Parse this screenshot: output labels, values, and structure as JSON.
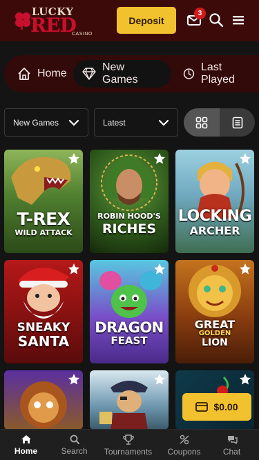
{
  "header": {
    "logo_lucky": "LUCKY",
    "logo_red": "RED",
    "logo_casino": "CASINO",
    "deposit_label": "Deposit",
    "notifications_count": "3"
  },
  "nav": {
    "items": [
      {
        "label": "Home",
        "icon": "house-icon"
      },
      {
        "label": "New Games",
        "icon": "diamond-icon",
        "active": true
      },
      {
        "label": "Last Played",
        "icon": "history-icon"
      }
    ]
  },
  "filters": {
    "category": "New Games",
    "sort": "Latest",
    "view": "grid"
  },
  "games": [
    {
      "line1": "T-REX",
      "line2": "WILD ATTACK"
    },
    {
      "line1": "ROBIN HOOD'S",
      "line2": "RICHES"
    },
    {
      "line1": "LOCKING",
      "line2": "ARCHER"
    },
    {
      "line1": "SNEAKY",
      "line2": "SANTA"
    },
    {
      "line1": "DRAGON",
      "line2": "FEAST"
    },
    {
      "line1": "GREAT",
      "line2": "GOLDEN",
      "line3": "LION"
    },
    {
      "line1": "",
      "line2": ""
    },
    {
      "line1": "",
      "line2": ""
    },
    {
      "line1": "",
      "line2": ""
    }
  ],
  "balance": "$0.00",
  "bottom_nav": [
    {
      "label": "Home",
      "active": true
    },
    {
      "label": "Search"
    },
    {
      "label": "Tournaments"
    },
    {
      "label": "Coupons"
    },
    {
      "label": "Chat"
    }
  ],
  "colors": {
    "header_bg": "#3d0a0a",
    "accent_yellow": "#f2c12e",
    "brand_red": "#c8102e",
    "page_bg": "#141414"
  }
}
